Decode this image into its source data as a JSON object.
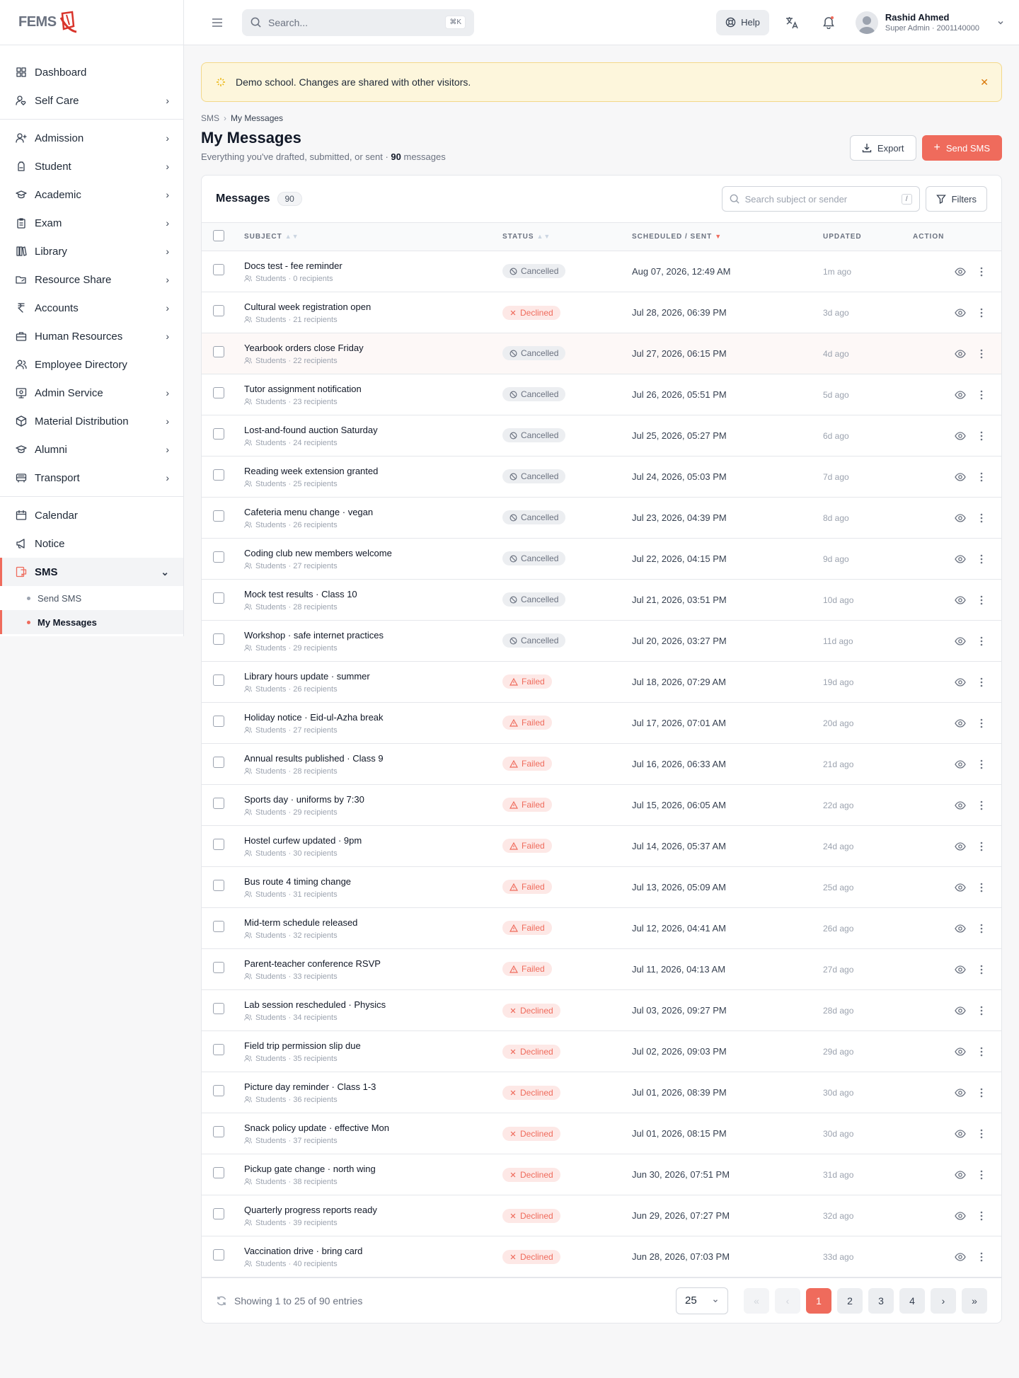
{
  "app": {
    "logo_text": "FEMS"
  },
  "sidebar": {
    "groups": [
      [
        {
          "label": "Dashboard",
          "icon": "grid-icon",
          "chevron": false
        },
        {
          "label": "Self Care",
          "icon": "user-heart-icon",
          "chevron": true
        }
      ],
      [
        {
          "label": "Admission",
          "icon": "user-plus-icon",
          "chevron": true
        },
        {
          "label": "Student",
          "icon": "backpack-icon",
          "chevron": true
        },
        {
          "label": "Academic",
          "icon": "graduation-cap-icon",
          "chevron": true
        },
        {
          "label": "Exam",
          "icon": "clipboard-icon",
          "chevron": true
        },
        {
          "label": "Library",
          "icon": "books-icon",
          "chevron": true
        },
        {
          "label": "Resource Share",
          "icon": "folder-share-icon",
          "chevron": true
        },
        {
          "label": "Accounts",
          "icon": "rupee-icon",
          "chevron": true
        },
        {
          "label": "Human Resources",
          "icon": "briefcase-icon",
          "chevron": true
        },
        {
          "label": "Employee Directory",
          "icon": "users-icon",
          "chevron": false
        },
        {
          "label": "Admin Service",
          "icon": "admin-service-icon",
          "chevron": true
        },
        {
          "label": "Material Distribution",
          "icon": "box-icon",
          "chevron": true
        },
        {
          "label": "Alumni",
          "icon": "graduation-cap-icon",
          "chevron": true
        },
        {
          "label": "Transport",
          "icon": "bus-icon",
          "chevron": true
        }
      ]
    ],
    "calendar": "Calendar",
    "notice": "Notice",
    "sms": "SMS",
    "sms_sub": [
      "Send SMS",
      "My Messages"
    ]
  },
  "topbar": {
    "search_placeholder": "Search...",
    "search_kbd": "⌘K",
    "help": "Help",
    "user_name": "Rashid Ahmed",
    "user_role": "Super Admin · 2001140000"
  },
  "banner": {
    "text": "Demo school. Changes are shared with other visitors."
  },
  "breadcrumb": [
    "SMS",
    "My Messages"
  ],
  "page": {
    "title": "My Messages",
    "subtitle_prefix": "Everything you've drafted, submitted, or sent ·",
    "subtitle_count": "90",
    "subtitle_suffix": "messages",
    "export": "Export",
    "send": "Send SMS"
  },
  "table": {
    "title": "Messages",
    "count": "90",
    "search_placeholder": "Search subject or sender",
    "slash": "/",
    "filters": "Filters",
    "headers": [
      "SUBJECT",
      "STATUS",
      "SCHEDULED / SENT",
      "UPDATED",
      "ACTION"
    ],
    "rows": [
      {
        "subject": "Docs test - fee reminder",
        "recipients": "Students · 0 recipients",
        "status": "Cancelled",
        "sent": "Aug 07, 2026, 12:49 AM",
        "updated": "1m ago"
      },
      {
        "subject": "Cultural week registration open",
        "recipients": "Students · 21 recipients",
        "status": "Declined",
        "sent": "Jul 28, 2026, 06:39 PM",
        "updated": "3d ago"
      },
      {
        "subject": "Yearbook orders close Friday",
        "recipients": "Students · 22 recipients",
        "status": "Cancelled",
        "sent": "Jul 27, 2026, 06:15 PM",
        "updated": "4d ago"
      },
      {
        "subject": "Tutor assignment notification",
        "recipients": "Students · 23 recipients",
        "status": "Cancelled",
        "sent": "Jul 26, 2026, 05:51 PM",
        "updated": "5d ago"
      },
      {
        "subject": "Lost-and-found auction Saturday",
        "recipients": "Students · 24 recipients",
        "status": "Cancelled",
        "sent": "Jul 25, 2026, 05:27 PM",
        "updated": "6d ago"
      },
      {
        "subject": "Reading week extension granted",
        "recipients": "Students · 25 recipients",
        "status": "Cancelled",
        "sent": "Jul 24, 2026, 05:03 PM",
        "updated": "7d ago"
      },
      {
        "subject": "Cafeteria menu change · vegan",
        "recipients": "Students · 26 recipients",
        "status": "Cancelled",
        "sent": "Jul 23, 2026, 04:39 PM",
        "updated": "8d ago"
      },
      {
        "subject": "Coding club new members welcome",
        "recipients": "Students · 27 recipients",
        "status": "Cancelled",
        "sent": "Jul 22, 2026, 04:15 PM",
        "updated": "9d ago"
      },
      {
        "subject": "Mock test results · Class 10",
        "recipients": "Students · 28 recipients",
        "status": "Cancelled",
        "sent": "Jul 21, 2026, 03:51 PM",
        "updated": "10d ago"
      },
      {
        "subject": "Workshop · safe internet practices",
        "recipients": "Students · 29 recipients",
        "status": "Cancelled",
        "sent": "Jul 20, 2026, 03:27 PM",
        "updated": "11d ago"
      },
      {
        "subject": "Library hours update · summer",
        "recipients": "Students · 26 recipients",
        "status": "Failed",
        "sent": "Jul 18, 2026, 07:29 AM",
        "updated": "19d ago"
      },
      {
        "subject": "Holiday notice · Eid-ul-Azha break",
        "recipients": "Students · 27 recipients",
        "status": "Failed",
        "sent": "Jul 17, 2026, 07:01 AM",
        "updated": "20d ago"
      },
      {
        "subject": "Annual results published · Class 9",
        "recipients": "Students · 28 recipients",
        "status": "Failed",
        "sent": "Jul 16, 2026, 06:33 AM",
        "updated": "21d ago"
      },
      {
        "subject": "Sports day · uniforms by 7:30",
        "recipients": "Students · 29 recipients",
        "status": "Failed",
        "sent": "Jul 15, 2026, 06:05 AM",
        "updated": "22d ago"
      },
      {
        "subject": "Hostel curfew updated · 9pm",
        "recipients": "Students · 30 recipients",
        "status": "Failed",
        "sent": "Jul 14, 2026, 05:37 AM",
        "updated": "24d ago"
      },
      {
        "subject": "Bus route 4 timing change",
        "recipients": "Students · 31 recipients",
        "status": "Failed",
        "sent": "Jul 13, 2026, 05:09 AM",
        "updated": "25d ago"
      },
      {
        "subject": "Mid-term schedule released",
        "recipients": "Students · 32 recipients",
        "status": "Failed",
        "sent": "Jul 12, 2026, 04:41 AM",
        "updated": "26d ago"
      },
      {
        "subject": "Parent-teacher conference RSVP",
        "recipients": "Students · 33 recipients",
        "status": "Failed",
        "sent": "Jul 11, 2026, 04:13 AM",
        "updated": "27d ago"
      },
      {
        "subject": "Lab session rescheduled · Physics",
        "recipients": "Students · 34 recipients",
        "status": "Declined",
        "sent": "Jul 03, 2026, 09:27 PM",
        "updated": "28d ago"
      },
      {
        "subject": "Field trip permission slip due",
        "recipients": "Students · 35 recipients",
        "status": "Declined",
        "sent": "Jul 02, 2026, 09:03 PM",
        "updated": "29d ago"
      },
      {
        "subject": "Picture day reminder · Class 1-3",
        "recipients": "Students · 36 recipients",
        "status": "Declined",
        "sent": "Jul 01, 2026, 08:39 PM",
        "updated": "30d ago"
      },
      {
        "subject": "Snack policy update · effective Mon",
        "recipients": "Students · 37 recipients",
        "status": "Declined",
        "sent": "Jul 01, 2026, 08:15 PM",
        "updated": "30d ago"
      },
      {
        "subject": "Pickup gate change · north wing",
        "recipients": "Students · 38 recipients",
        "status": "Declined",
        "sent": "Jun 30, 2026, 07:51 PM",
        "updated": "31d ago"
      },
      {
        "subject": "Quarterly progress reports ready",
        "recipients": "Students · 39 recipients",
        "status": "Declined",
        "sent": "Jun 29, 2026, 07:27 PM",
        "updated": "32d ago"
      },
      {
        "subject": "Vaccination drive · bring card",
        "recipients": "Students · 40 recipients",
        "status": "Declined",
        "sent": "Jun 28, 2026, 07:03 PM",
        "updated": "33d ago"
      }
    ]
  },
  "footer": {
    "showing": "Showing 1 to 25 of 90 entries",
    "per_page": "25",
    "pages": [
      "1",
      "2",
      "3",
      "4"
    ]
  },
  "colors": {
    "accent": "#ef6b5c",
    "banner_bg": "#fdf6dc"
  }
}
